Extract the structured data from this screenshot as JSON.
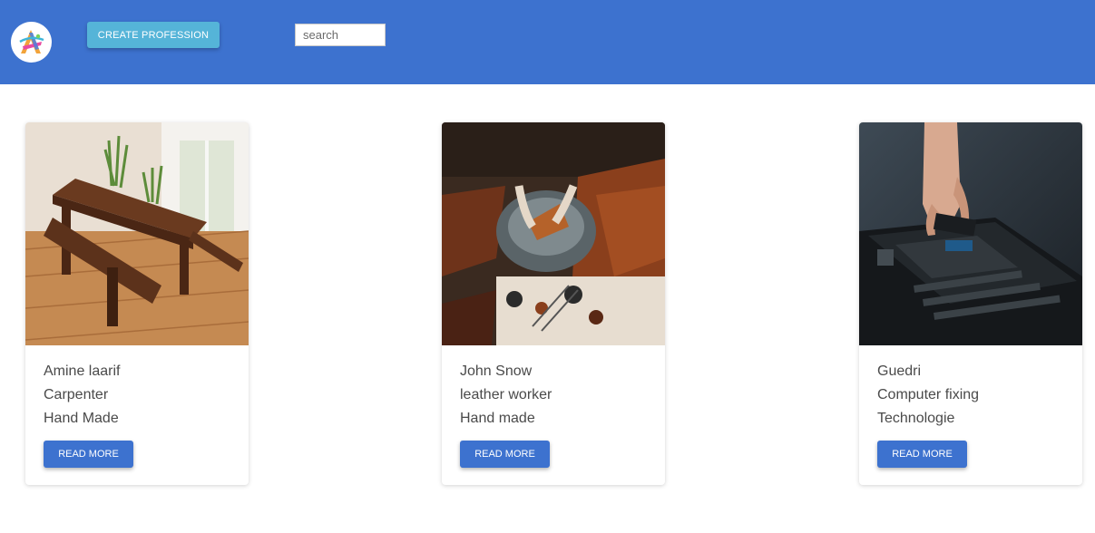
{
  "header": {
    "background_color": "#3d72cf",
    "logo_icon": "app-logo-icon",
    "create_button_label": "CREATE PROFESSION",
    "create_button_color": "#55b4d8",
    "search": {
      "placeholder": "search",
      "value": ""
    }
  },
  "cards": [
    {
      "image_icon": "wooden-table-photo",
      "name": "Amine laarif",
      "profession": "Carpenter",
      "category": "Hand Made",
      "button_label": "READ MORE"
    },
    {
      "image_icon": "leather-workshop-photo",
      "name": "John Snow",
      "profession": "leather worker",
      "category": "Hand made",
      "button_label": "READ MORE"
    },
    {
      "image_icon": "motherboard-photo",
      "name": "Guedri",
      "profession": "Computer fixing",
      "category": "Technologie",
      "button_label": "READ MORE"
    }
  ],
  "colors": {
    "primary": "#3d72cf",
    "text": "#4a4a4a"
  }
}
